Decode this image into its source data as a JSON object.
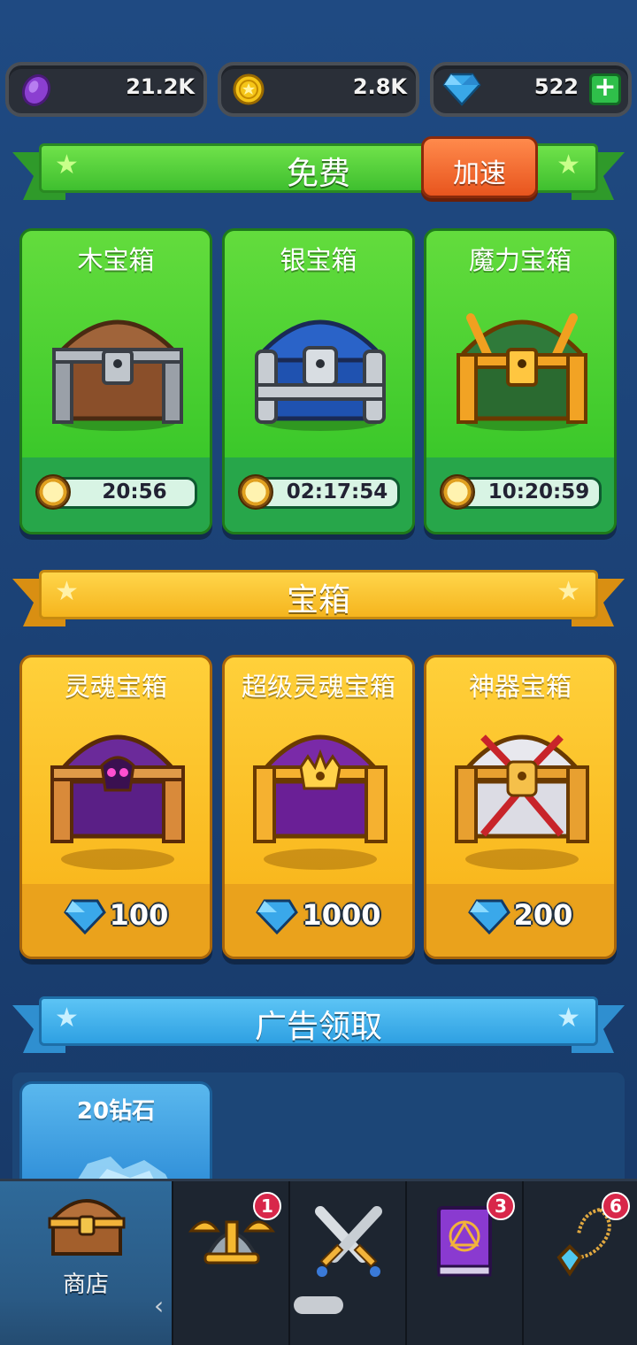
{
  "currency": {
    "purple_value": "21.2K",
    "gold_value": "2.8K",
    "gem_value": "522",
    "add_label": "+"
  },
  "free_section": {
    "title": "免费",
    "speedup_label": "加速",
    "chests": [
      {
        "name": "木宝箱",
        "timer": "20:56"
      },
      {
        "name": "银宝箱",
        "timer": "02:17:54"
      },
      {
        "name": "魔力宝箱",
        "timer": "10:20:59"
      }
    ]
  },
  "chest_section": {
    "title": "宝箱",
    "chests": [
      {
        "name": "灵魂宝箱",
        "price": "100"
      },
      {
        "name": "超级灵魂宝箱",
        "price": "1000"
      },
      {
        "name": "神器宝箱",
        "price": "200"
      }
    ]
  },
  "ad_section": {
    "title": "广告领取",
    "offer_name": "20钻石"
  },
  "nav": {
    "shop_label": "商店",
    "heroes_badge": "1",
    "book_badge": "3",
    "amulet_badge": "6"
  },
  "colors": {
    "free_green": "#4fcf3a",
    "chest_yellow": "#f9c32c",
    "ad_blue": "#2f9ee0",
    "speedup_orange": "#f26a2e"
  }
}
